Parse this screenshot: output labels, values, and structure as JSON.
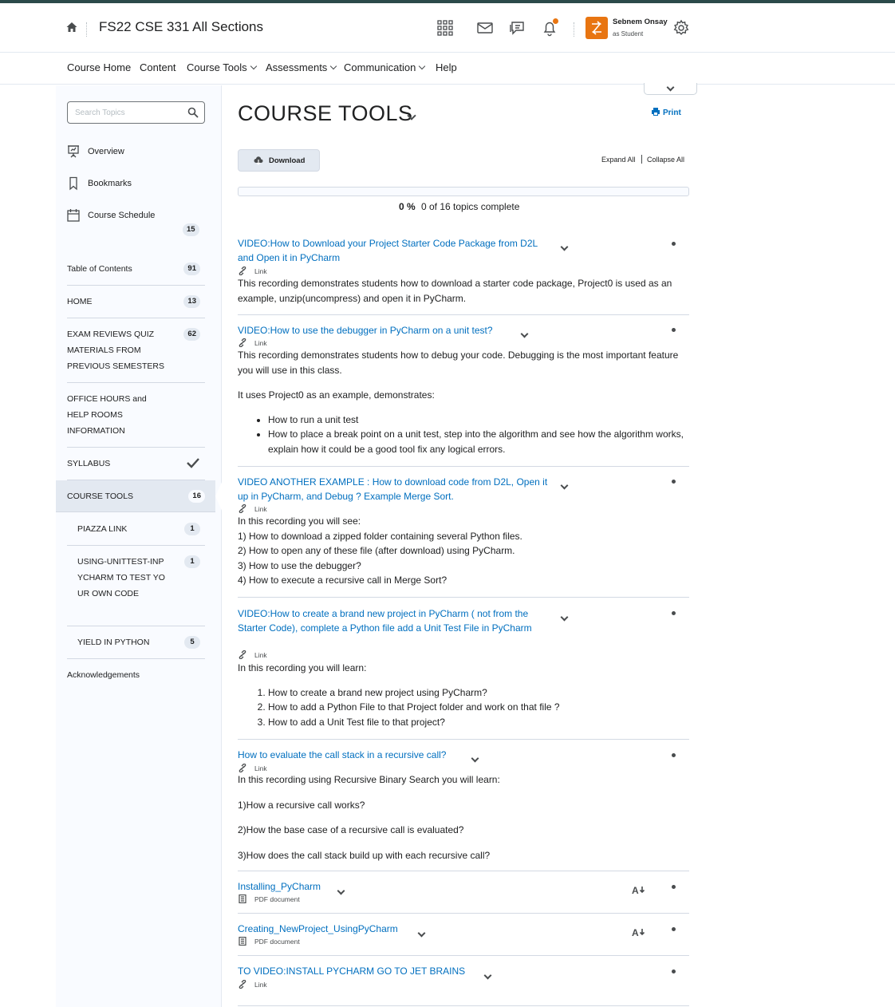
{
  "header": {
    "course_title": "FS22 CSE 331 All Sections",
    "user_name": "Sebnem Onsay",
    "user_role": "as Student",
    "accent_color": "#e87511"
  },
  "nav": {
    "items": [
      "Course Home",
      "Content",
      "Course Tools",
      "Assessments",
      "Communication",
      "Help"
    ]
  },
  "sidebar": {
    "search_placeholder": "Search Topics",
    "links": [
      "Overview",
      "Bookmarks",
      "Course Schedule"
    ],
    "schedule_count": "15",
    "toc": [
      {
        "label": "Table of Contents",
        "count": "91"
      },
      {
        "label": "HOME",
        "count": "13"
      },
      {
        "label": "EXAM REVIEWS QUIZ MATERIALS FROM PREVIOUS SEMESTERS",
        "count": "62"
      },
      {
        "label": "OFFICE HOURS and HELP ROOMS INFORMATION",
        "count": ""
      },
      {
        "label": "SYLLABUS",
        "count": ""
      },
      {
        "label": "COURSE TOOLS",
        "count": "16"
      },
      {
        "label": "PIAZZA LINK",
        "count": "1"
      },
      {
        "label": "USING-UNITTEST-INPYCHARM TO TEST YOUR OWN CODE",
        "count": "1"
      },
      {
        "label": "YIELD IN PYTHON",
        "count": "5"
      },
      {
        "label": "Acknowledgements",
        "count": ""
      }
    ]
  },
  "main": {
    "title": "COURSE TOOLS",
    "print_label": "Print",
    "download_label": "Download",
    "expand_all": "Expand All",
    "collapse_all": "Collapse All",
    "progress_percent": "0 %",
    "progress_fraction": 0,
    "progress_text": "0 of 16 topics complete",
    "topics": [
      {
        "title": "VIDEO:How to Download your Project Starter Code Package from D2L and Open it in PyCharm",
        "type": "Link",
        "description": [
          "This recording demonstrates  students how to download a starter code package, Project0 is used as an example, unzip(uncompress) and open it in PyCharm."
        ]
      },
      {
        "title": "VIDEO:How to use the debugger in PyCharm on a unit test?",
        "type": "Link",
        "description": [
          "This recording demonstrates students how to debug your code. Debugging is the most important feature you will use in this class.",
          "It uses Project0 as an example, demonstrates:"
        ],
        "bullets": [
          "How to run a unit test",
          "How to place a break point on a unit test, step into the algorithm and see how the algorithm works, explain how it could be a good tool fix any logical errors."
        ]
      },
      {
        "title": "VIDEO ANOTHER EXAMPLE : How to download code from D2L, Open it up in PyCharm, and Debug ? Example Merge Sort.",
        "type": "Link",
        "description": [
          "In this recording you will see:",
          "1) How to download a zipped folder containing several Python files.",
          "2) How to open any of these file (after download) using PyCharm.",
          "3) How to use the debugger?",
          "4) How to execute a recursive call in Merge Sort?"
        ]
      },
      {
        "title": "VIDEO:How to create a brand new project in PyCharm ( not from the Starter Code), complete a Python file add a Unit Test File in PyCharm",
        "type": "Link",
        "description": [
          "In this recording you will learn:"
        ],
        "numbered": [
          "How to create a brand new project using PyCharm?",
          "How to add a Python File to that Project folder and work on that file ?",
          "How to add a Unit Test file to that project?"
        ]
      },
      {
        "title": "How to evaluate the call stack in a recursive call?",
        "type": "Link",
        "description": [
          "In this recording using Recursive Binary Search you will learn:",
          "1)How a recursive call works?",
          "2)How the base case of a recursive call is evaluated?",
          "3)How does the call stack build up with each recursive call?"
        ]
      },
      {
        "title": "Installing_PyCharm",
        "type": "PDF document"
      },
      {
        "title": "Creating_NewProject_UsingPyCharm",
        "type": "PDF document"
      },
      {
        "title": "TO VIDEO:INSTALL PYCHARM GO TO JET BRAINS",
        "type": "Link"
      }
    ]
  }
}
